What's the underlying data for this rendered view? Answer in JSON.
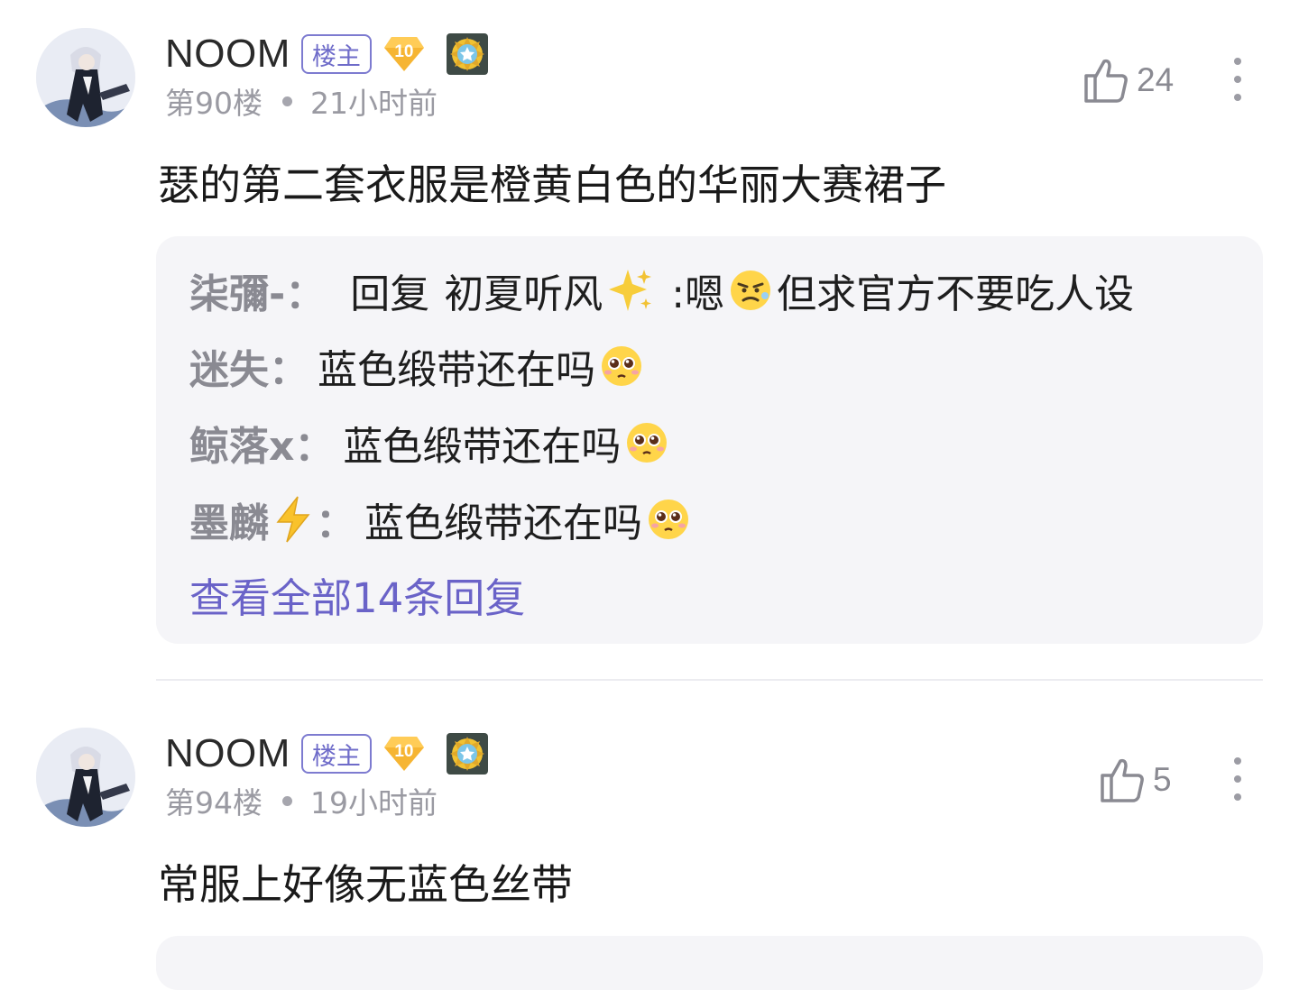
{
  "posts": [
    {
      "username": "NOOM",
      "op_badge": "楼主",
      "level": "10",
      "floor": "第90楼",
      "time": "21小时前",
      "likes": "24",
      "content": "瑟的第二套衣服是橙黄白色的华丽大赛裙子",
      "replies": [
        {
          "author": "柒彌-",
          "sep": "：",
          "reply_label": "回复",
          "reply_to": "初夏听风",
          "text_a": ":嗯",
          "text_b": "但求官方不要吃人设"
        },
        {
          "author": "迷失",
          "sep": "：",
          "text": "蓝色缎带还在吗"
        },
        {
          "author": "鲸落x",
          "sep": "：",
          "text": "蓝色缎带还在吗"
        },
        {
          "author": "墨麟",
          "sep": "：",
          "text": "蓝色缎带还在吗"
        }
      ],
      "view_all": "查看全部14条回复"
    },
    {
      "username": "NOOM",
      "op_badge": "楼主",
      "level": "10",
      "floor": "第94楼",
      "time": "19小时前",
      "likes": "5",
      "content": "常服上好像无蓝色丝带"
    }
  ],
  "icons": {
    "like": "thumbs-up-icon",
    "more": "more-vertical-icon",
    "level": "diamond-badge-icon",
    "medal": "star-medal-icon",
    "sparkle": "sparkles-emoji",
    "lightning": "lightning-emoji",
    "pleading": "pleading-face-emoji",
    "annoyed": "annoyed-face-emoji"
  },
  "colors": {
    "accent": "#6a63c8",
    "badge_border": "#7d7bd0",
    "level_badge": "#f5b335",
    "reply_bg": "#f5f5f8",
    "meta_text": "#9a9aa2"
  }
}
